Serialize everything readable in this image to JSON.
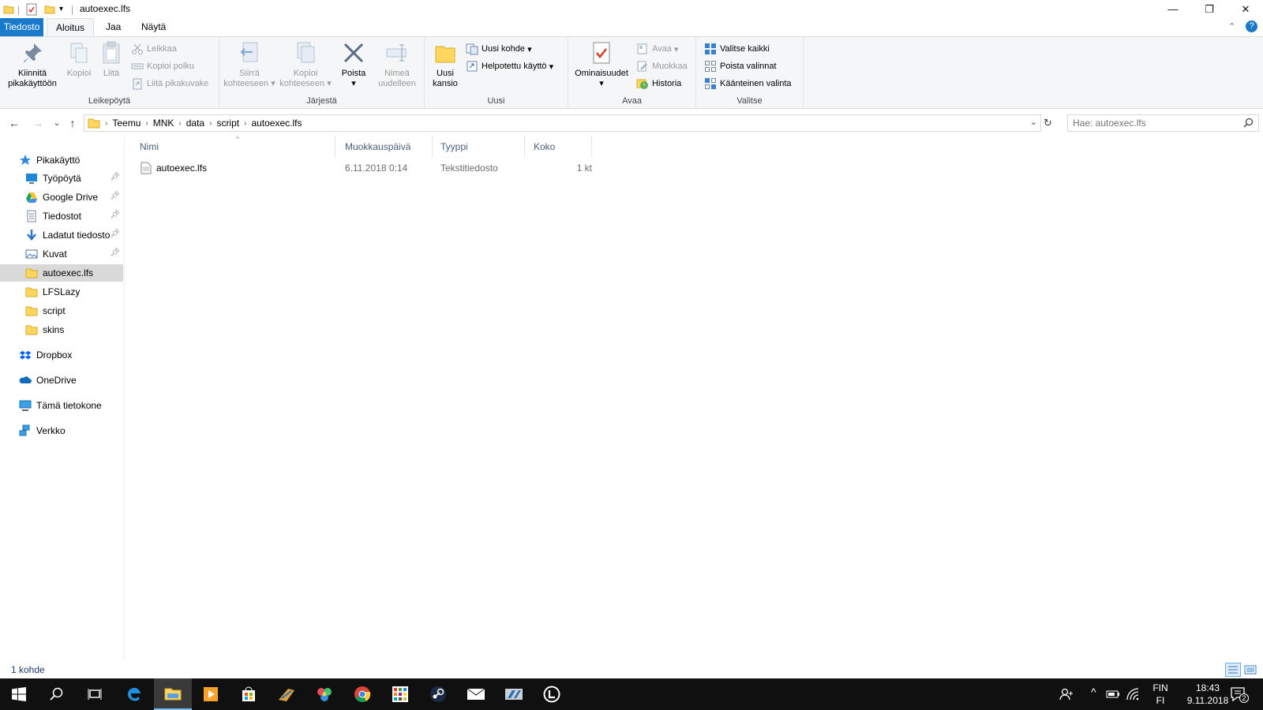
{
  "window": {
    "title": "autoexec.lfs",
    "controls": {
      "minimize": "—",
      "restore": "❐",
      "close": "✕"
    }
  },
  "ribbon_tabs": [
    "Tiedosto",
    "Aloitus",
    "Jaa",
    "Näytä"
  ],
  "ribbon": {
    "clipboard": {
      "pin": "Kiinnitä pikakäyttöön",
      "copy": "Kopioi",
      "paste": "Liitä",
      "cut": "Leikkaa",
      "copy_path": "Kopioi polku",
      "paste_shortcut": "Liitä pikakuvake",
      "label": "Leikepöytä"
    },
    "organize": {
      "move_to": "Siirrä kohteeseen",
      "copy_to": "Kopioi kohteeseen",
      "delete": "Poista",
      "rename": "Nimeä uudelleen",
      "label": "Järjestä"
    },
    "new": {
      "new_folder": "Uusi kansio",
      "new_item": "Uusi kohde",
      "easy_access": "Helpotettu käyttö",
      "label": "Uusi"
    },
    "open": {
      "properties": "Ominaisuudet",
      "open": "Avaa",
      "edit": "Muokkaa",
      "history": "Historia",
      "label": "Avaa"
    },
    "select": {
      "select_all": "Valitse kaikki",
      "select_none": "Poista valinnat",
      "invert": "Käänteinen valinta",
      "label": "Valitse"
    }
  },
  "address": {
    "breadcrumbs": [
      "Teemu",
      "MNK",
      "data",
      "script",
      "autoexec.lfs"
    ]
  },
  "search": {
    "placeholder": "Hae: autoexec.lfs"
  },
  "nav": {
    "quick_access": "Pikakäyttö",
    "items": [
      {
        "label": "Työpöytä",
        "pinned": true,
        "icon": "desktop-icon"
      },
      {
        "label": "Google Drive",
        "pinned": true,
        "icon": "google-drive-icon"
      },
      {
        "label": "Tiedostot",
        "pinned": true,
        "icon": "documents-icon"
      },
      {
        "label": "Ladatut tiedosto",
        "pinned": true,
        "icon": "downloads-icon"
      },
      {
        "label": "Kuvat",
        "pinned": true,
        "icon": "pictures-icon"
      },
      {
        "label": "autoexec.lfs",
        "pinned": false,
        "icon": "folder-icon",
        "selected": true
      },
      {
        "label": "LFSLazy",
        "pinned": false,
        "icon": "folder-icon"
      },
      {
        "label": "script",
        "pinned": false,
        "icon": "folder-icon"
      },
      {
        "label": "skins",
        "pinned": false,
        "icon": "folder-icon"
      }
    ],
    "dropbox": "Dropbox",
    "onedrive": "OneDrive",
    "this_pc": "Tämä tietokone",
    "network": "Verkko"
  },
  "columns": {
    "name": "Nimi",
    "modified": "Muokkauspäivä",
    "type": "Tyyppi",
    "size": "Koko"
  },
  "files": [
    {
      "name": "autoexec.lfs",
      "modified": "6.11.2018 0:14",
      "type": "Tekstitiedosto",
      "size": "1 kt"
    }
  ],
  "status": {
    "count": "1 kohde"
  },
  "taskbar": {
    "lang_top": "FIN",
    "lang_bottom": "FI",
    "time": "18:43",
    "date": "9.11.2018",
    "notification_count": "2"
  },
  "colors": {
    "accent": "#1979ca",
    "folder": "#ffd75e",
    "ribbon_bg": "#f5f6f7",
    "taskbar_bg": "#101010"
  }
}
